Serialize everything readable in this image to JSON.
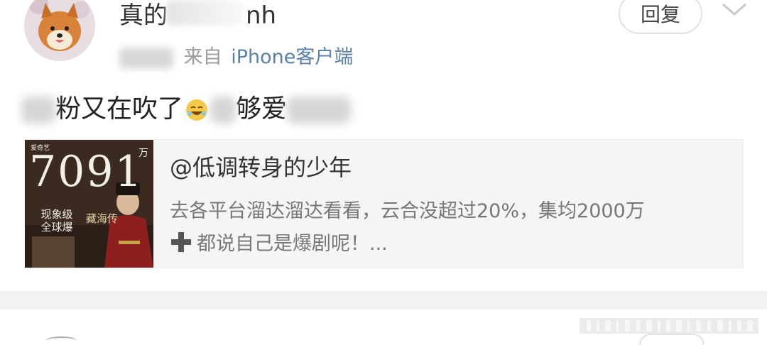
{
  "post": {
    "username": "真的",
    "username_tail": "nh",
    "from_label": "来自",
    "source": "iPhone客户端",
    "reply_label": "回复",
    "content_visible_1": "粉又在吹了",
    "content_visible_2": "够爱",
    "icons": [
      "avatar",
      "chevron-down-icon",
      "laughing-emoji-icon"
    ]
  },
  "repost": {
    "author": "@低调转身的少年",
    "text": "去各平台溜达溜达看看，云合没超过20%，集均2000万",
    "text_line2": "都说自己是爆剧呢！...",
    "thumbnail": {
      "number": "7091",
      "unit": "万",
      "caption_left": "现象级 全球爆",
      "caption_right": "藏海传",
      "badge": "爱奇艺"
    }
  },
  "colors": {
    "source_link": "#5a7faa",
    "divider": "#f2f2f2",
    "repost_bg": "#f5f5f5",
    "plus_icon": "#555555"
  }
}
